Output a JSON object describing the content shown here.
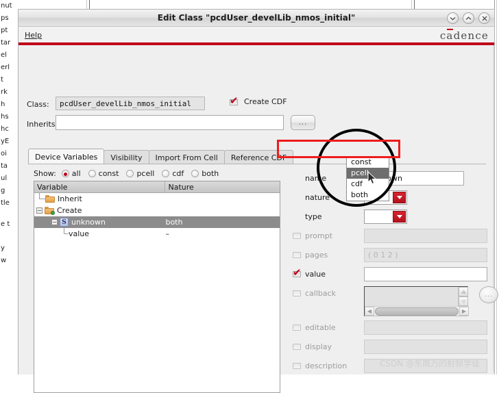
{
  "background": {
    "left_strip_lines": [
      "nut",
      "ps",
      "pt",
      "tar",
      "el",
      "erl",
      "t",
      "rk",
      "h",
      "hs",
      "hc",
      "yE",
      "oi",
      "ta",
      "ul",
      "g",
      "tle",
      "e t",
      "y",
      "w"
    ]
  },
  "window": {
    "title": "Edit Class \"pcdUser_develLib_nmos_initial\"",
    "buttons": {
      "minimize": "minimize-icon",
      "maximize": "maximize-icon",
      "close": "close-icon"
    }
  },
  "menubar": {
    "help_label": "Help",
    "brand": {
      "c": "c",
      "a": "a",
      "rest": "dence"
    }
  },
  "form": {
    "class_label": "Class:",
    "class_value": "pcdUser_develLib_nmos_initial",
    "create_cdf_label": "Create CDF",
    "create_cdf_checked": true,
    "inherits_label": "Inherits",
    "inherits_value": "",
    "browse_label": "..."
  },
  "tabs": [
    {
      "label": "Device Variables",
      "active": true
    },
    {
      "label": "Visibility",
      "active": false
    },
    {
      "label": "Import From Cell",
      "active": false
    },
    {
      "label": "Reference CDF",
      "active": false
    }
  ],
  "show": {
    "label": "Show:",
    "options": [
      {
        "label": "all",
        "selected": true
      },
      {
        "label": "const",
        "selected": false
      },
      {
        "label": "pcell",
        "selected": false
      },
      {
        "label": "cdf",
        "selected": false
      },
      {
        "label": "both",
        "selected": false
      }
    ]
  },
  "tree": {
    "columns": [
      "Variable",
      "Nature"
    ],
    "rows": [
      {
        "name": "Inherit",
        "nature": "",
        "icon": "folder-icon",
        "selected": false
      },
      {
        "name": "Create",
        "nature": "",
        "icon": "folder-add-icon",
        "selected": false
      },
      {
        "name": "unknown",
        "nature": "both",
        "icon": "s-variable-icon",
        "selected": true
      },
      {
        "name": "value",
        "nature": "–",
        "icon": "none",
        "selected": false
      }
    ]
  },
  "properties": {
    "name": {
      "label": "name",
      "value": "unknown",
      "enabled": true,
      "checkbox": false
    },
    "nature": {
      "label": "nature",
      "value": "both",
      "enabled": true,
      "checkbox": false
    },
    "type": {
      "label": "type",
      "value": "",
      "enabled": true,
      "checkbox": false
    },
    "prompt": {
      "label": "prompt",
      "value": "",
      "enabled": false,
      "checkbox": true,
      "checked": false
    },
    "pages": {
      "label": "pages",
      "value": "( 0 1 2 )",
      "enabled": false,
      "checkbox": true,
      "checked": false
    },
    "value": {
      "label": "value",
      "value": "",
      "enabled": true,
      "checkbox": true,
      "checked": true
    },
    "callback": {
      "label": "callback",
      "value": "",
      "enabled": false,
      "checkbox": true,
      "checked": false,
      "browse_label": "..."
    },
    "editable": {
      "label": "editable",
      "value": "",
      "enabled": false,
      "checkbox": true,
      "checked": false
    },
    "display": {
      "label": "display",
      "value": "",
      "enabled": false,
      "checkbox": true,
      "checked": false
    },
    "description": {
      "label": "description",
      "value": "",
      "enabled": false,
      "checkbox": true,
      "checked": false
    }
  },
  "nature_dropdown": {
    "open": true,
    "options": [
      {
        "label": "const",
        "highlighted": false
      },
      {
        "label": "pcell",
        "highlighted": true
      },
      {
        "label": "cdf",
        "highlighted": false
      },
      {
        "label": "both",
        "highlighted": false
      }
    ]
  },
  "annotations": {
    "highlight_color": "#ee1b1b",
    "magnifier_color": "#000000",
    "accent_color": "#c00018"
  },
  "watermark": "CSDN @东南万的射频学徒"
}
